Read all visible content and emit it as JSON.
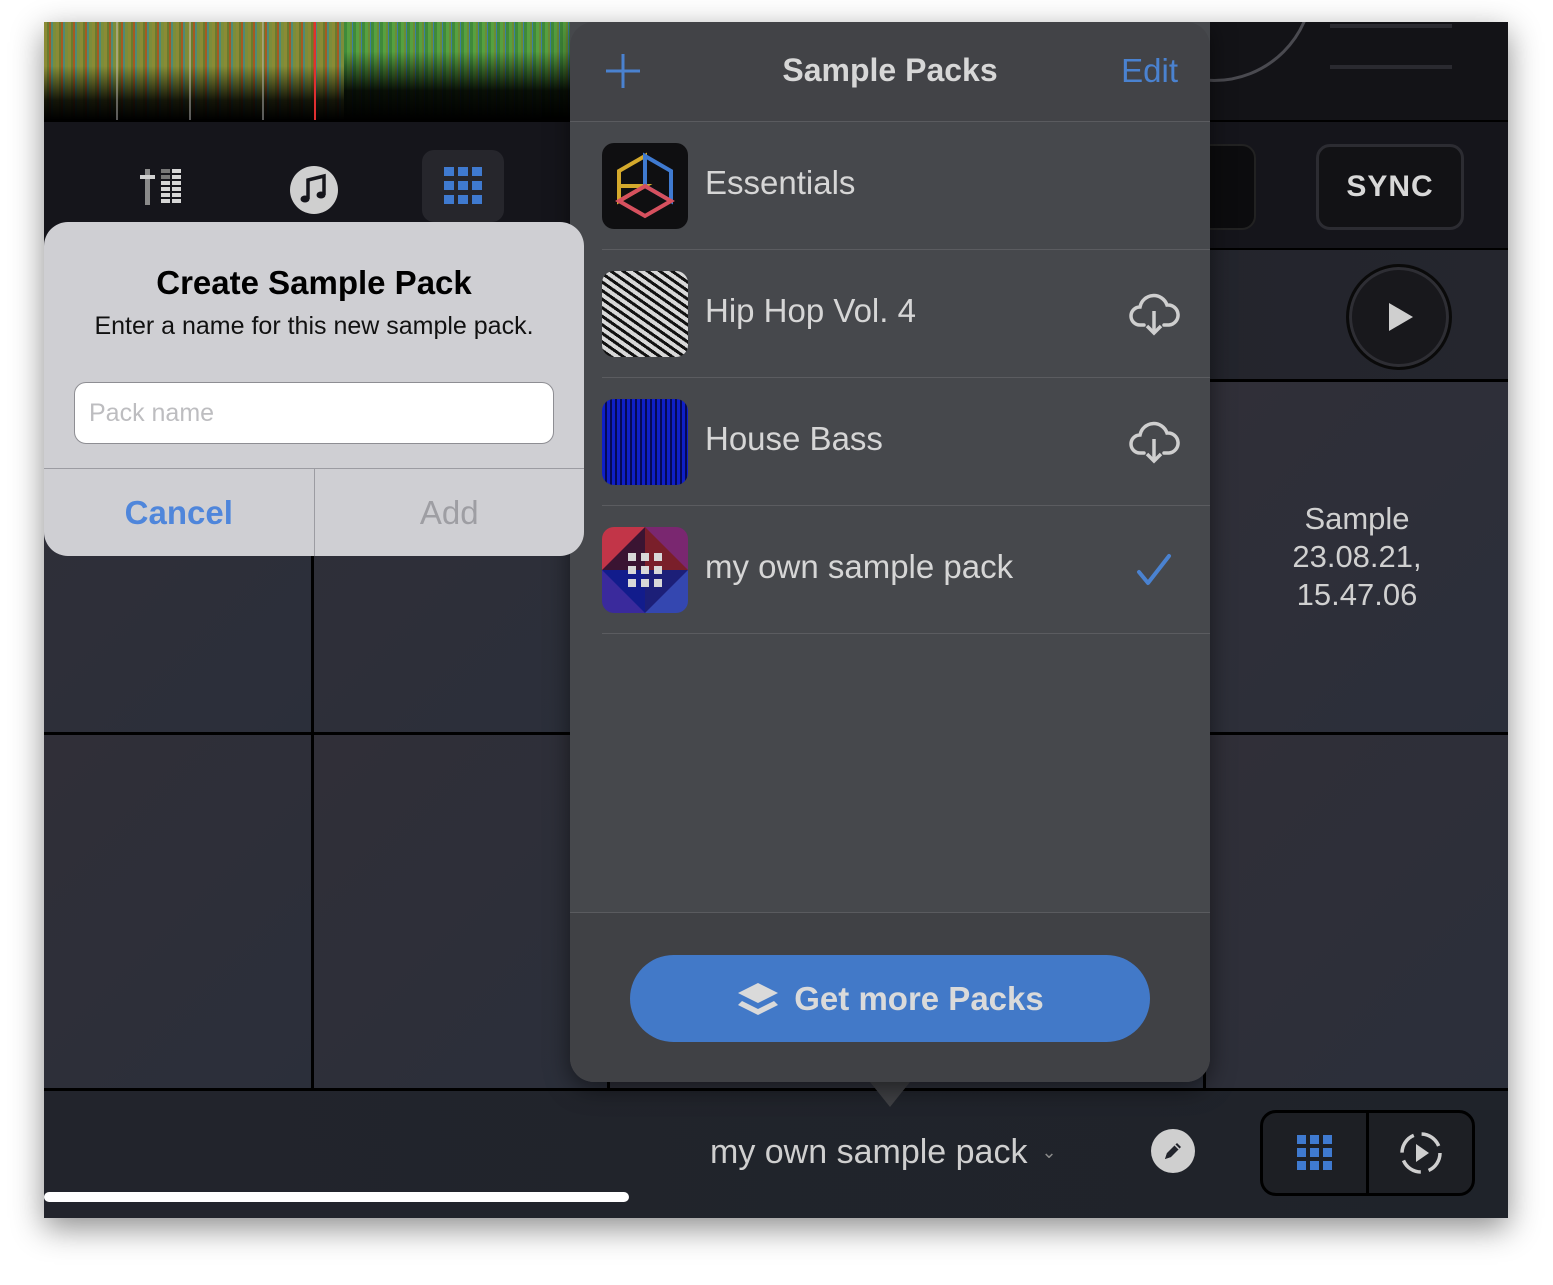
{
  "deck": {
    "sync_label": "SYNC",
    "tools": [
      {
        "name": "mixer",
        "icon": "mixer-icon",
        "active": false
      },
      {
        "name": "music",
        "icon": "music-note-icon",
        "active": false
      },
      {
        "name": "sampler",
        "icon": "grid-icon",
        "active": true
      }
    ]
  },
  "pads": {
    "sample_label": "Sample\n23.08.21,\n15.47.06"
  },
  "bottom_bar": {
    "selected_pack": "my own sample pack",
    "chevron": "⌄"
  },
  "popover": {
    "title": "Sample Packs",
    "add_icon": "plus-icon",
    "edit_label": "Edit",
    "packs": [
      {
        "name": "Essentials",
        "accessory": "none"
      },
      {
        "name": "Hip Hop Vol. 4",
        "accessory": "cloud-download-icon"
      },
      {
        "name": "House Bass",
        "accessory": "cloud-download-icon"
      },
      {
        "name": "my own sample pack",
        "accessory": "checkmark-icon",
        "selected": true
      }
    ],
    "get_more_label": "Get more Packs"
  },
  "dialog": {
    "title": "Create Sample Pack",
    "message": "Enter a name for this new sample pack.",
    "input_value": "",
    "input_placeholder": "Pack name",
    "cancel_label": "Cancel",
    "add_label": "Add"
  },
  "colors": {
    "accent": "#4279c8",
    "link": "#4a82d0",
    "popover_bg": "#46484c",
    "dialog_bg": "#cfcfd3"
  }
}
